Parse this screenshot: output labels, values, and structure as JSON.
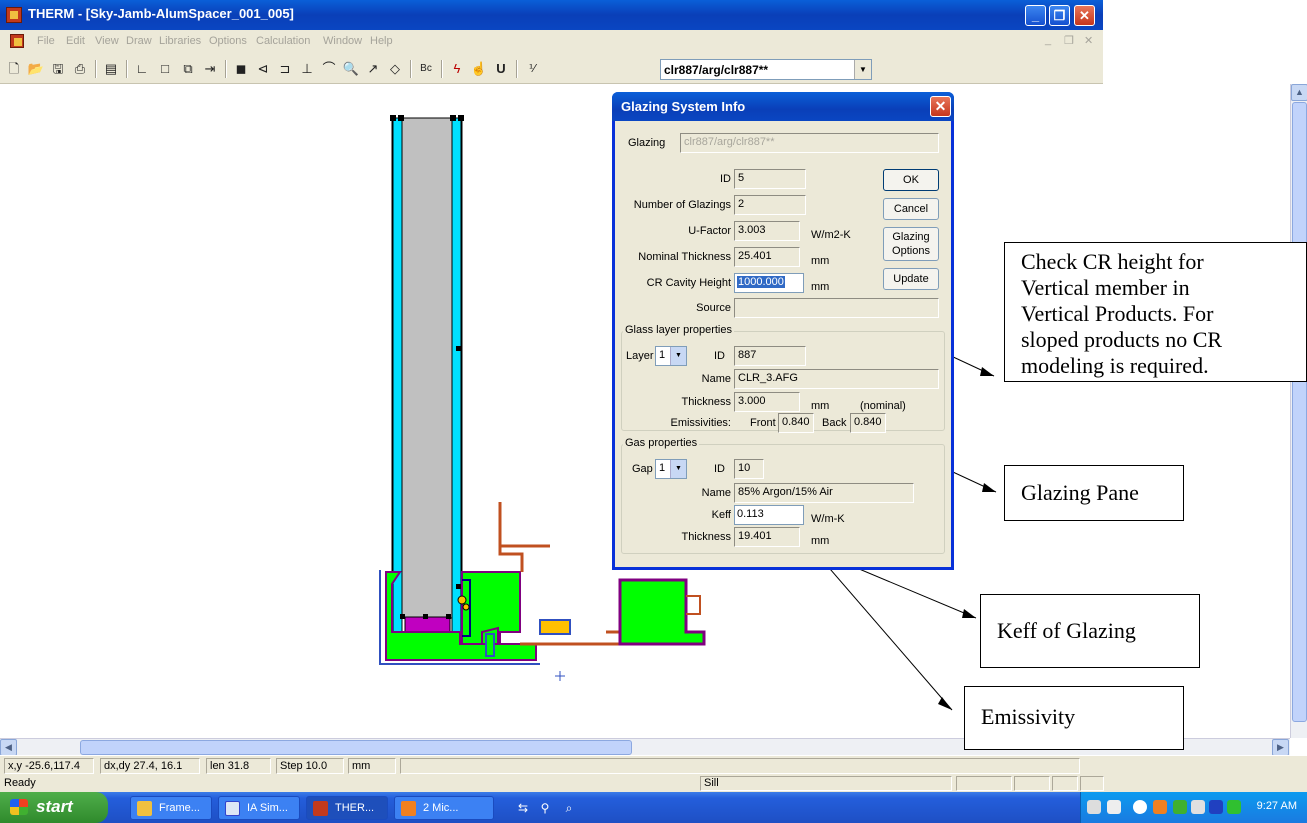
{
  "window": {
    "title": "THERM - [Sky-Jamb-AlumSpacer_001_005]",
    "minimize": "_",
    "maximize": "❐",
    "close": "✕"
  },
  "menu": {
    "items": [
      "File",
      "Edit",
      "View",
      "Draw",
      "Libraries",
      "Options",
      "Calculation",
      "Window",
      "Help"
    ],
    "mdi_controls": [
      "_",
      "❐",
      "✕"
    ]
  },
  "toolbar": {
    "glazing_combo_value": "clr887/arg/clr887**"
  },
  "dialog": {
    "title": "Glazing System Info",
    "close": "✕",
    "glazing_label": "Glazing",
    "glazing_value": "clr887/arg/clr887**",
    "id_label": "ID",
    "id_value": "5",
    "num_glazings_label": "Number of Glazings",
    "num_glazings_value": "2",
    "ufactor_label": "U-Factor",
    "ufactor_value": "3.003",
    "ufactor_unit": "W/m2-K",
    "nominal_thickness_label": "Nominal Thickness",
    "nominal_thickness_value": "25.401",
    "nominal_thickness_unit": "mm",
    "cr_height_label": "CR Cavity Height",
    "cr_height_value": "1000.000",
    "cr_height_unit": "mm",
    "source_label": "Source",
    "source_value": "",
    "buttons": {
      "ok": "OK",
      "cancel": "Cancel",
      "glazing_options_line1": "Glazing",
      "glazing_options_line2": "Options",
      "update": "Update"
    },
    "glass_group": {
      "title": "Glass layer properties",
      "layer_label": "Layer",
      "layer_value": "1",
      "id_label": "ID",
      "id_value": "887",
      "name_label": "Name",
      "name_value": "CLR_3.AFG",
      "thickness_label": "Thickness",
      "thickness_value": "3.000",
      "thickness_unit": "mm",
      "thickness_note": "(nominal)",
      "emissivities_label": "Emissivities:",
      "front_label": "Front",
      "front_value": "0.840",
      "back_label": "Back",
      "back_value": "0.840"
    },
    "gas_group": {
      "title": "Gas properties",
      "gap_label": "Gap",
      "gap_value": "1",
      "id_label": "ID",
      "id_value": "10",
      "name_label": "Name",
      "name_value": "85% Argon/15% Air",
      "keff_label": "Keff",
      "keff_value": "0.113",
      "keff_unit": "W/m-K",
      "thickness_label": "Thickness",
      "thickness_value": "19.401",
      "thickness_unit": "mm"
    }
  },
  "callouts": {
    "cr_height_lines": [
      "Check CR height for",
      "Vertical member in",
      "Vertical Products. For",
      "sloped products no CR",
      "modeling is required."
    ],
    "glazing_pane": "Glazing Pane",
    "keff": "Keff of Glazing",
    "emissivity": "Emissivity"
  },
  "statusbar": {
    "xy": "x,y -25.6,117.4",
    "dxdy": "dx,dy  27.4, 16.1",
    "len": "len  31.8",
    "step": "Step  10.0",
    "units": "mm",
    "ready": "Ready",
    "sill": "Sill"
  },
  "taskbar": {
    "start": "start",
    "tasks": [
      "Frame...",
      "IA Sim...",
      "THER...",
      "2 Mic..."
    ],
    "clock": "9:27 AM"
  },
  "colors": {
    "frame_fill": "#00ff00",
    "frame_outline": "#800080",
    "glass_edge": "#00e0ff",
    "glass_fill": "#c0c0c0",
    "spacer_fill": "#c000c0",
    "gasket_fill": "#ffc000",
    "titlebar_blue": "#0a46c2"
  }
}
